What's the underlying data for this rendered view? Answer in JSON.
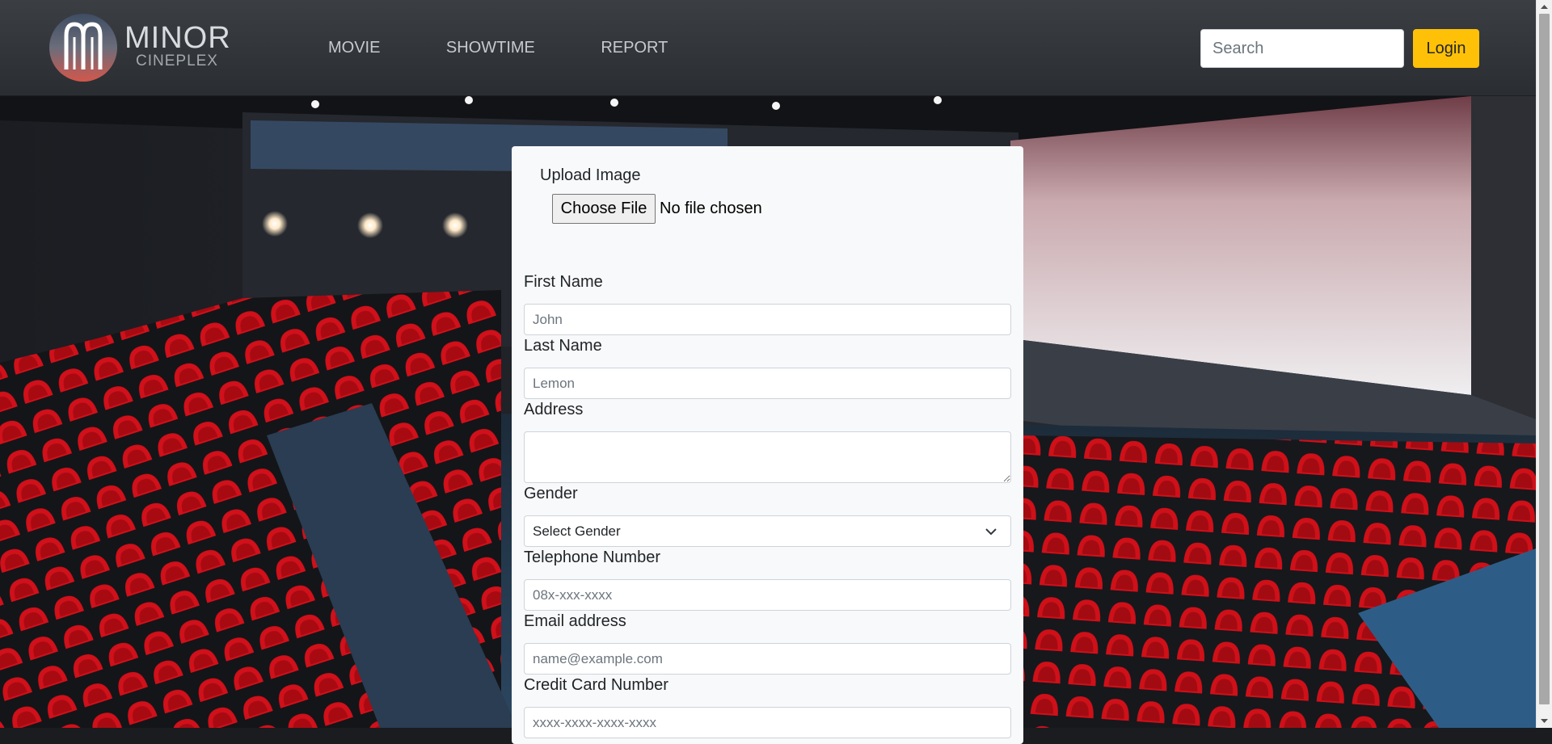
{
  "brand": {
    "name_line1": "MINOR",
    "name_line2": "CINEPLEX"
  },
  "nav": {
    "items": [
      {
        "label": "MOVIE"
      },
      {
        "label": "SHOWTIME"
      },
      {
        "label": "REPORT"
      }
    ],
    "search_placeholder": "Search",
    "login_label": "Login"
  },
  "form": {
    "upload_label": "Upload Image",
    "file_button_label": "Choose File",
    "file_status": "No file chosen",
    "first_name": {
      "label": "First Name",
      "placeholder": "John",
      "value": ""
    },
    "last_name": {
      "label": "Last Name",
      "placeholder": "Lemon",
      "value": ""
    },
    "address": {
      "label": "Address",
      "value": ""
    },
    "gender": {
      "label": "Gender",
      "selected": "Select Gender"
    },
    "telephone": {
      "label": "Telephone Number",
      "placeholder": "08x-xxx-xxxx",
      "value": ""
    },
    "email": {
      "label": "Email address",
      "placeholder": "name@example.com",
      "value": ""
    },
    "credit_card": {
      "label": "Credit Card Number",
      "placeholder": "xxxx-xxxx-xxxx-xxxx",
      "value": ""
    }
  },
  "colors": {
    "navbar": "#33373b",
    "accent": "#ffc107",
    "card_bg": "#f8f9fa",
    "seat_red": "#d0101a"
  },
  "icons": {
    "logo": "minor-cineplex-logo",
    "select_arrow": "chevron-down-icon"
  }
}
